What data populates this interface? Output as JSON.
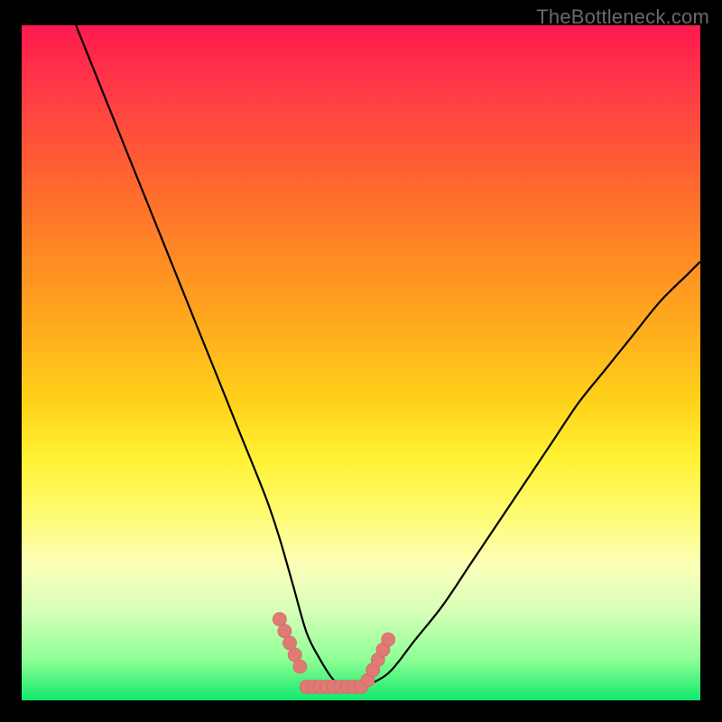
{
  "watermark": "TheBottleneck.com",
  "colors": {
    "curve_stroke": "#000000",
    "marker_fill": "#e07a74",
    "marker_stroke": "#d36a64",
    "background_black": "#000000"
  },
  "chart_data": {
    "type": "line",
    "title": "",
    "xlabel": "",
    "ylabel": "",
    "xlim": [
      0,
      100
    ],
    "ylim": [
      0,
      100
    ],
    "gradient_legend_note": "background gradient from red (top, ~100) through yellow (~40) to green (bottom, ~0) represents bottleneck percentage (red high, green low)",
    "series": [
      {
        "name": "bottleneck-curve",
        "x": [
          8,
          12,
          16,
          20,
          24,
          28,
          32,
          36,
          38,
          40,
          42,
          44,
          46,
          48,
          50,
          54,
          58,
          62,
          66,
          70,
          74,
          78,
          82,
          86,
          90,
          94,
          98,
          100
        ],
        "y": [
          100,
          90,
          80,
          70,
          60,
          50,
          40,
          30,
          24,
          17,
          10,
          6,
          3,
          2,
          2,
          4,
          9,
          14,
          20,
          26,
          32,
          38,
          44,
          49,
          54,
          59,
          63,
          65
        ]
      }
    ],
    "markers": {
      "note": "short salmon bead segments along the curve near the valley bottom",
      "left_segment": {
        "x": [
          38,
          41
        ],
        "y": [
          12,
          5
        ]
      },
      "bottom_segment": {
        "x": [
          42,
          50
        ],
        "y": [
          2,
          2
        ]
      },
      "right_segment": {
        "x": [
          51,
          54
        ],
        "y": [
          3,
          9
        ]
      }
    }
  }
}
